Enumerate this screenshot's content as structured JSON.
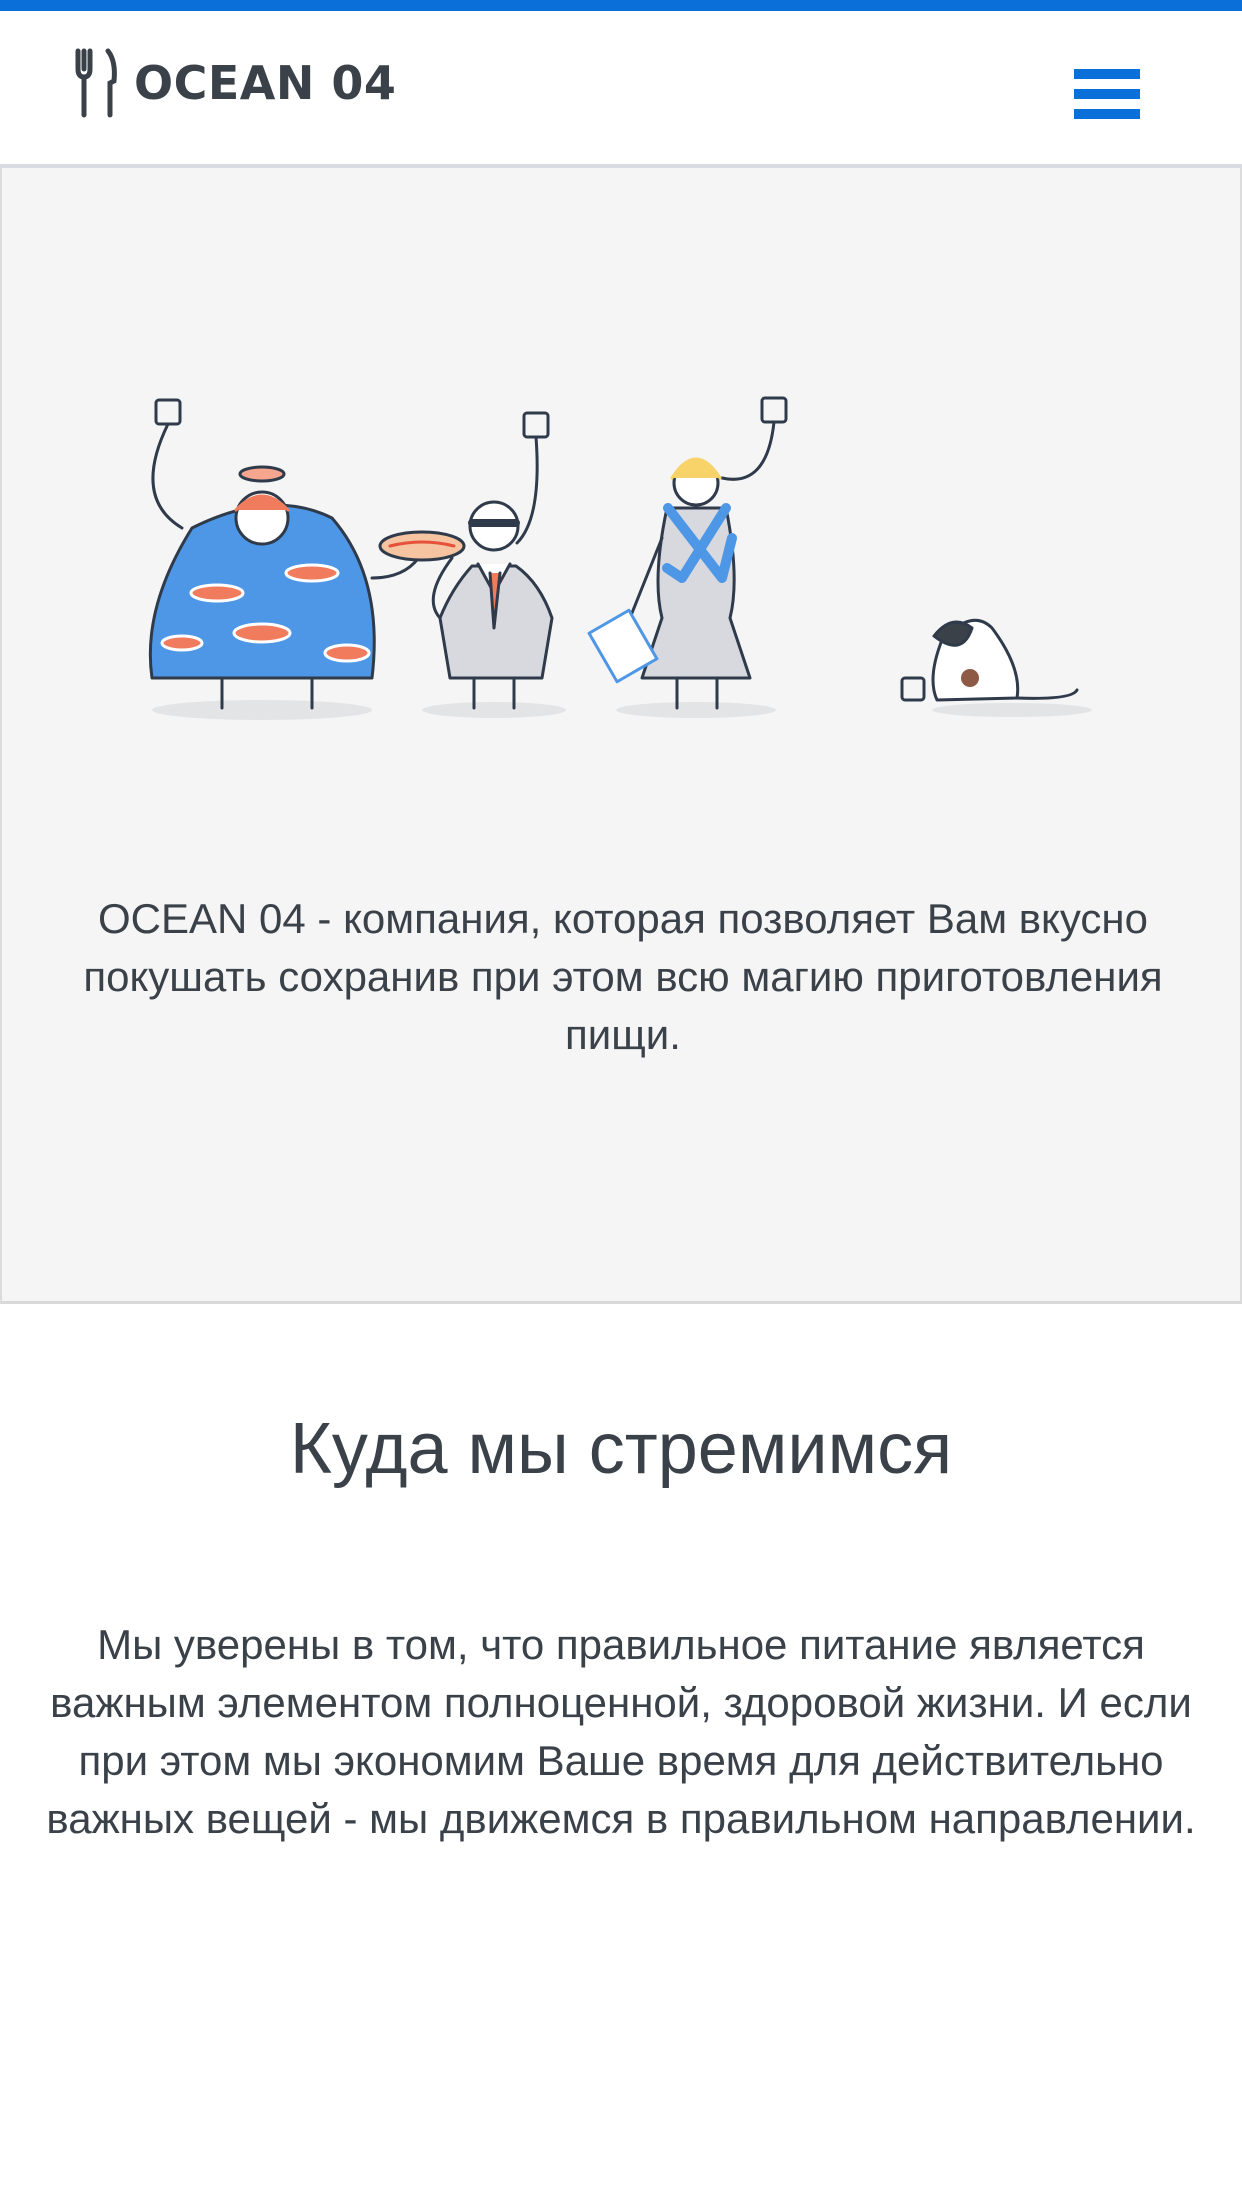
{
  "header": {
    "brand": "OCEAN 04",
    "logo_icon": "fork-knife-icon",
    "menu_icon": "hamburger-menu-icon",
    "accent_color": "#0a6fd8"
  },
  "hero": {
    "illustration": "people-and-dog-illustration",
    "text": "OCEAN 04 - компания, которая позволяет Вам вкусно покушать сохранив при этом всю магию приготовления пищи."
  },
  "mission": {
    "title": "Куда мы стремимся",
    "text": "Мы уверены в том, что правильное питание является важным элементом полноценной, здоровой жизни. И если при этом мы экономим Ваше время для действительно важных вещей - мы движемся в правильном направлении."
  }
}
